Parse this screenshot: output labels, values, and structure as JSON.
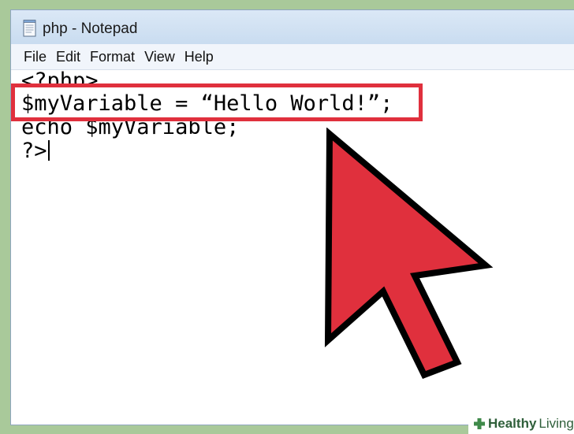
{
  "window": {
    "title": "php - Notepad"
  },
  "menubar": {
    "items": [
      {
        "label": "File"
      },
      {
        "label": "Edit"
      },
      {
        "label": "Format"
      },
      {
        "label": "View"
      },
      {
        "label": "Help"
      }
    ]
  },
  "editor": {
    "lines": [
      "<?php>",
      "$myVariable = “Hello World!”;",
      "echo $myVariable;",
      "?>"
    ],
    "highlighted_line_index": 1
  },
  "annotation": {
    "highlight_color": "#e0303d",
    "cursor_icon": "mouse-pointer-arrow",
    "cursor_color": "#e0303d"
  },
  "watermark": {
    "brand_bold": "Healthy",
    "brand_regular": "Living",
    "icon": "plus-icon",
    "color": "#2f5f3a"
  }
}
